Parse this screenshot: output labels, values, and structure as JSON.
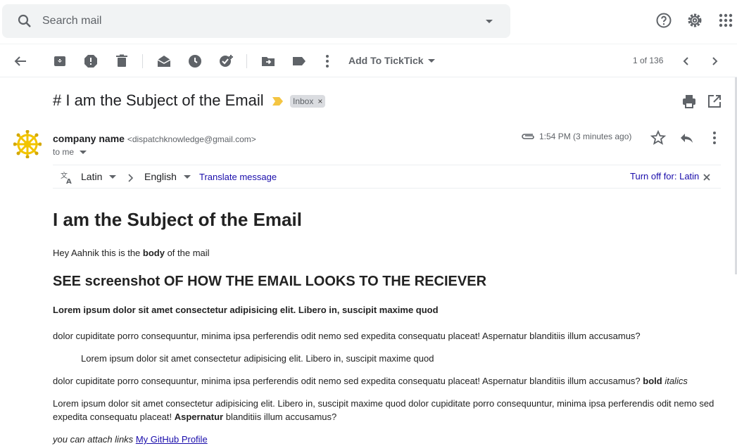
{
  "search": {
    "placeholder": "Search mail"
  },
  "toolbar": {
    "addon_label": "Add To TickTick",
    "pager": "1 of 136"
  },
  "email": {
    "subject": "# I am the Subject of the Email",
    "label": "Inbox",
    "label_remove": "×",
    "sender_name": "company name",
    "sender_email": "<dispatchknowledge@gmail.com>",
    "to": "to me",
    "time": "1:54 PM (3 minutes ago)"
  },
  "translate": {
    "from": "Latin",
    "to": "English",
    "action": "Translate message",
    "turn_off": "Turn off for: Latin"
  },
  "body": {
    "heading": "I am the Subject of the Email",
    "greeting_pre": "Hey Aahnik this is the ",
    "greeting_bold": "body",
    "greeting_post": " of the mail",
    "h2": "SEE screenshot OF HOW THE EMAIL LOOKS TO THE RECIEVER",
    "bold_line": "Lorem ipsum dolor sit amet consectetur adipisicing elit. Libero in, suscipit maxime quod",
    "para1": "dolor cupiditate porro consequuntur, minima ipsa perferendis odit nemo sed expedita consequatu placeat! Aspernatur blanditiis illum accusamus?",
    "quote": "Lorem ipsum dolor sit amet consectetur adipisicing elit. Libero in, suscipit maxime quod",
    "para2": "dolor cupiditate porro consequuntur, minima ipsa perferendis odit nemo sed expedita consequatu placeat! Aspernatur blanditiis illum accusamus? ",
    "para2_bold": "bold",
    "para2_italic": "italics",
    "para3_line1": "Lorem ipsum dolor sit amet consectetur adipisicing elit. Libero in, suscipit maxime quod dolor cupiditate porro consequuntur, minima ipsa perferendis odit nemo sed",
    "para3_line2_pre": "expedita consequatu placeat! ",
    "para3_bold": "Aspernatur",
    "para3_line2_post": " blanditiis illum accusamus?",
    "link_pre": "you can attach links",
    "link_text": "My GitHub Profile"
  },
  "colors": {
    "important_marker": "#f4c542",
    "avatar": "#f2c400",
    "link": "#1a0dab"
  }
}
